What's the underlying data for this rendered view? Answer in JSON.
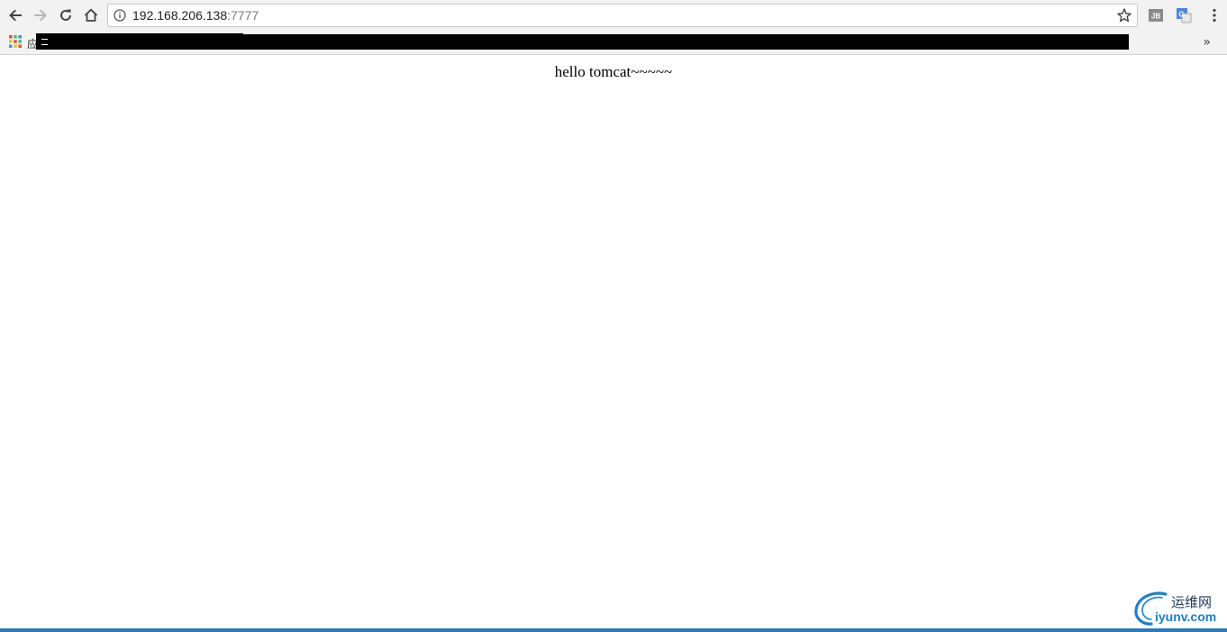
{
  "toolbar": {
    "url_host": "192.168.206.138",
    "url_port": ":7777"
  },
  "extensions": [
    {
      "name": "jb-extension-icon",
      "label": "JB"
    },
    {
      "name": "translate-extension-icon",
      "label": "G"
    }
  ],
  "bookmarks": {
    "apps_label": "应",
    "more": "»"
  },
  "page": {
    "message": "hello tomcat~~~~~"
  },
  "watermark": {
    "cn": "运维网",
    "en": "iyunv.com"
  },
  "colors": {
    "toolbar_bg": "#f2f2f2",
    "accent_blue": "#2b7bb8"
  }
}
